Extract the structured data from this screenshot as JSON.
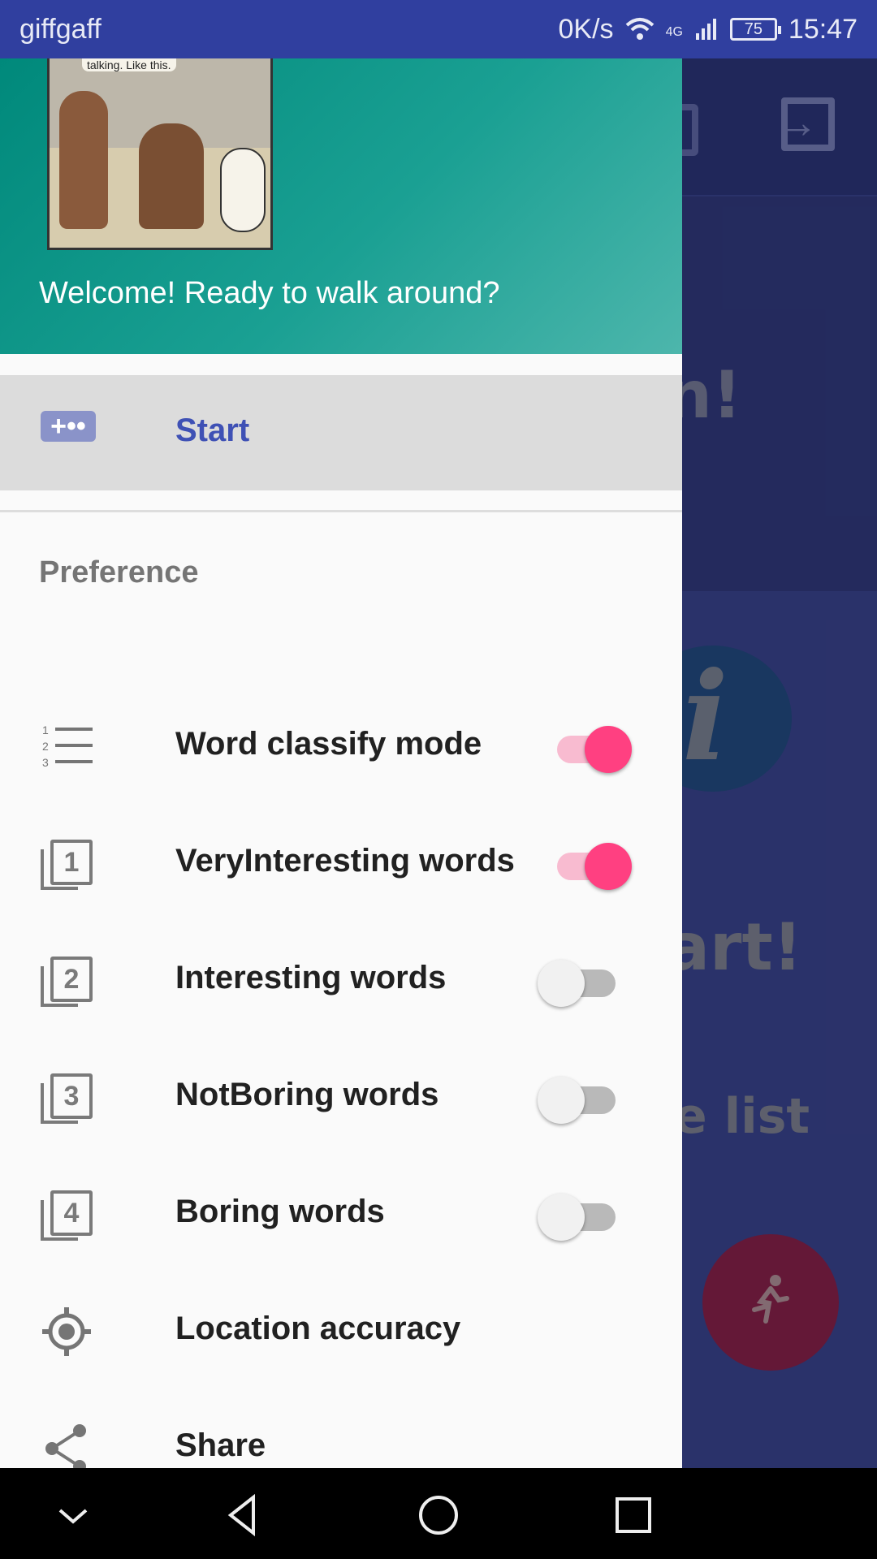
{
  "status_bar": {
    "carrier": "giffgaff",
    "speed": "0K/s",
    "network": "4G",
    "battery": "75",
    "time": "15:47"
  },
  "background": {
    "banner_text": "n!",
    "start_text": "art!",
    "list_text": "e list"
  },
  "drawer": {
    "header": {
      "welcome": "Welcome! Ready to walk around?",
      "comic_caption": "talking. Like this."
    },
    "start": {
      "label": "Start",
      "icon": "gamepad-icon"
    },
    "preference_title": "Preference",
    "items": [
      {
        "label": "Word classify mode",
        "icon": "numbered-list-icon",
        "toggle": true
      },
      {
        "label": "VeryInteresting words",
        "icon": "filter-1-icon",
        "number": "1",
        "toggle": true
      },
      {
        "label": "Interesting words",
        "icon": "filter-2-icon",
        "number": "2",
        "toggle": false
      },
      {
        "label": "NotBoring words",
        "icon": "filter-3-icon",
        "number": "3",
        "toggle": false
      },
      {
        "label": "Boring words",
        "icon": "filter-4-icon",
        "number": "4",
        "toggle": false
      },
      {
        "label": "Location accuracy",
        "icon": "gps-icon"
      },
      {
        "label": "Share",
        "icon": "share-icon"
      }
    ]
  },
  "colors": {
    "status_bar": "#303f9f",
    "header_gradient_start": "#00897b",
    "accent": "#ff4081",
    "start_label": "#3f51b5"
  }
}
